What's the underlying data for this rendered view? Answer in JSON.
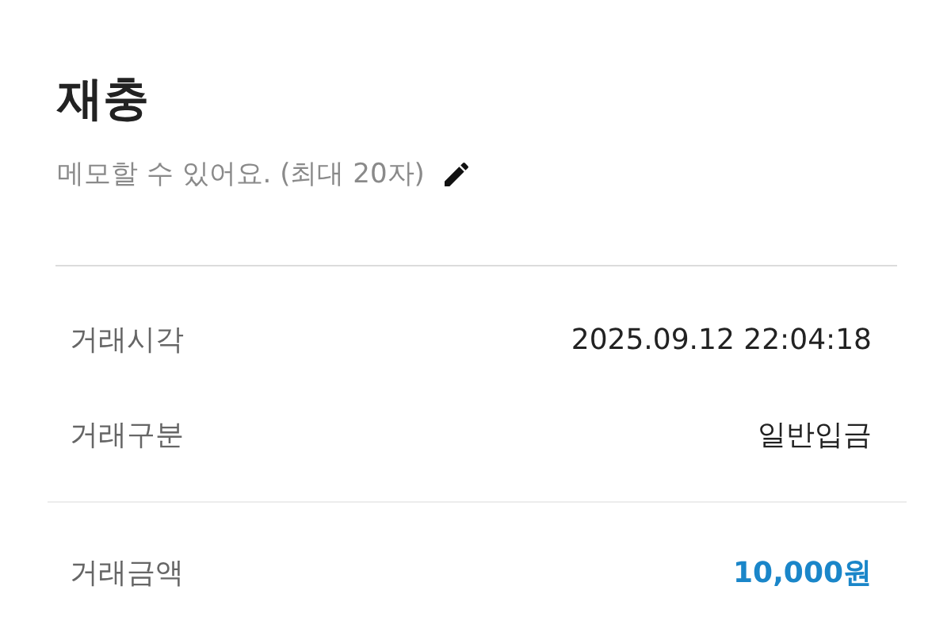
{
  "title": "재충",
  "memo": {
    "placeholder": "메모할 수 있어요. (최대 20자)"
  },
  "details": [
    {
      "label": "거래시각",
      "value": "2025.09.12 22:04:18"
    },
    {
      "label": "거래구분",
      "value": "일반입금"
    }
  ],
  "amount": {
    "label": "거래금액",
    "value": "10,000원"
  }
}
